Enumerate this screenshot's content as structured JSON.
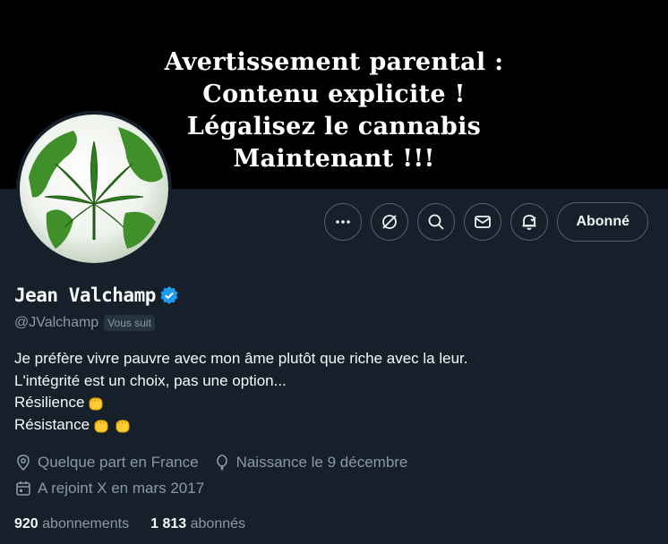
{
  "banner": {
    "lines": [
      "Avertissement parental :",
      "Contenu explicite !",
      "Légalisez le cannabis",
      "Maintenant !!!"
    ]
  },
  "profile": {
    "name": "Jean Valchamp",
    "handle": "@JValchamp",
    "follows_you": "Vous suit",
    "verified": true,
    "bio": [
      "Je préfère vivre pauvre avec mon âme plutôt que riche avec la leur.",
      "L'intégrité est un choix, pas une option...",
      "Résilience",
      "Résistance"
    ],
    "location": "Quelque part en France",
    "birthday": "Naissance le 9 décembre",
    "joined": "A rejoint X en mars 2017",
    "following_count": "920",
    "following_label": "abonnements",
    "followers_count": "1 813",
    "followers_label": "abonnés"
  },
  "actions": {
    "follow_label": "Abonné",
    "icons": [
      "more-icon",
      "grok-icon",
      "search-icon",
      "message-icon",
      "notification-bell-icon"
    ]
  },
  "colors": {
    "background": "#15202b",
    "banner": "#000000",
    "verified": "#1d9bf0",
    "muted_text": "#8b98a5",
    "avatar_green": "#2e7d1f"
  }
}
